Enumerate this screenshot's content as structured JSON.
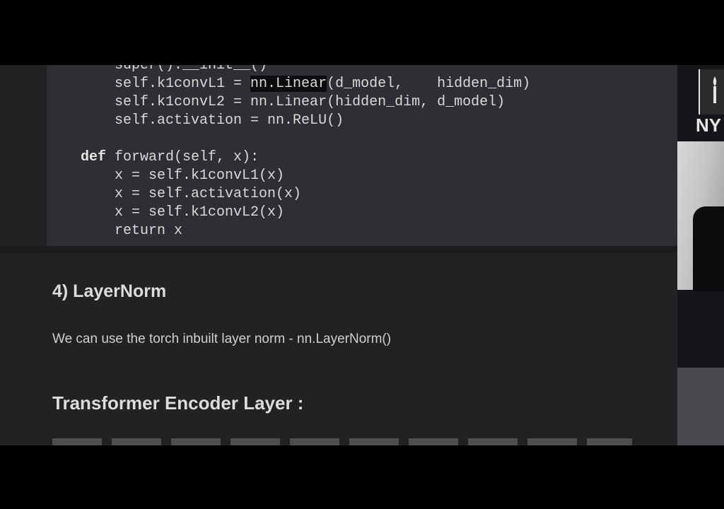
{
  "code": {
    "lines": [
      {
        "text": "        super().__init__()"
      },
      {
        "text_pre": "        self.k1convL1 = ",
        "highlight": "nn.Linear",
        "text_post": "(d_model,    hidden_dim)"
      },
      {
        "text": "        self.k1convL2 = nn.Linear(hidden_dim, d_model)"
      },
      {
        "text": "        self.activation = nn.ReLU()"
      },
      {
        "text": ""
      },
      {
        "keyword": "def",
        "text": " forward(self, x):",
        "indent": "    "
      },
      {
        "text": "        x = self.k1convL1(x)"
      },
      {
        "text": "        x = self.activation(x)"
      },
      {
        "text": "        x = self.k1convL2(x)"
      },
      {
        "text": "        return x"
      }
    ]
  },
  "section_heading": "4) LayerNorm",
  "paragraph": "We can use the torch inbuilt layer norm - nn.LayerNorm()",
  "transformer_heading": "Transformer Encoder Layer :",
  "webcam": {
    "brand_text": "NY",
    "logo_icon": "torch-icon"
  },
  "colors": {
    "background": "#000000",
    "page": "#222224",
    "code_bg": "#2e2e33",
    "text": "#d9d9d9"
  }
}
